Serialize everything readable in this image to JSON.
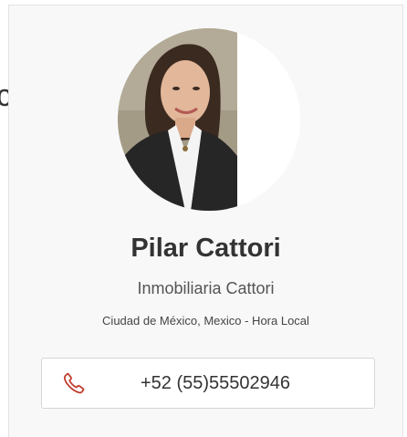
{
  "left_fragment": "c",
  "profile": {
    "name": "Pilar Cattori",
    "company": "Inmobiliaria Cattori",
    "location": "Ciudad de México, Mexico - Hora Local",
    "phone": "+52 (55)55502946"
  },
  "icons": {
    "phone": "phone-icon"
  },
  "colors": {
    "accent": "#c0392b",
    "card_bg": "#f8f8f8",
    "text": "#333333"
  }
}
